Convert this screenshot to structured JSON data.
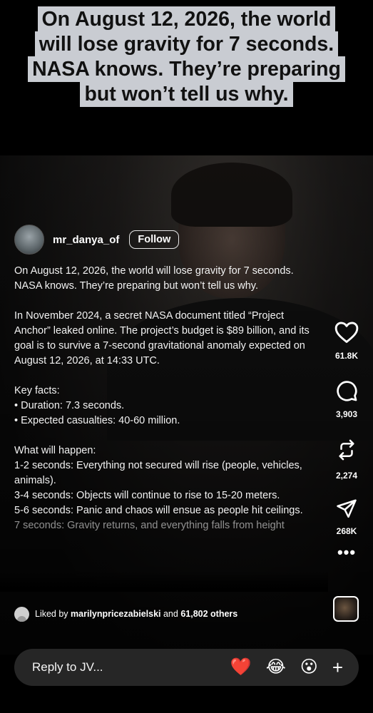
{
  "top_caption": "On August 12, 2026, the world will lose gravity for 7 seconds. NASA knows. They’re preparing but won’t tell us why.",
  "post": {
    "username": "mr_danya_of",
    "follow_label": "Follow",
    "caption": {
      "intro": "On August 12, 2026, the world will lose gravity for 7 seconds. NASA knows. They’re preparing but won’t tell us why.",
      "paragraph2": "In November 2024, a secret NASA document titled “Project Anchor” leaked online. The project’s budget is $89 billion, and its goal is to survive a 7-second gravitational anomaly expected on August 12, 2026, at 14:33 UTC.",
      "key_facts_heading": "Key facts:",
      "key_facts": [
        "• Duration: 7.3 seconds.",
        "• Expected casualties: 40-60 million."
      ],
      "what_heading": "What will happen:",
      "what_items": [
        "1-2 seconds: Everything not secured will rise (people, vehicles, animals).",
        "3-4 seconds: Objects will continue to rise to 15-20 meters.",
        "5-6 seconds: Panic and chaos will ensue as people hit ceilings.",
        "7 seconds: Gravity returns, and everything falls from height"
      ]
    },
    "liked_by": {
      "prefix": "Liked by",
      "user": "marilynpricezabielski",
      "connector": "and",
      "others": "61,802 others"
    }
  },
  "actions": {
    "likes": "61.8K",
    "comments": "3,903",
    "reposts": "2,274",
    "shares": "268K",
    "more_glyph": "•••",
    "icons": [
      "heart-icon",
      "comment-icon",
      "repost-icon",
      "share-icon",
      "more-icon"
    ]
  },
  "reply": {
    "placeholder": "Reply to JV...",
    "reactions": [
      "❤️",
      "😂",
      "😮"
    ],
    "plus": "+"
  },
  "colors": {
    "background": "#000000",
    "caption_box": "#c9ccd2",
    "reply_bar": "#262626"
  }
}
